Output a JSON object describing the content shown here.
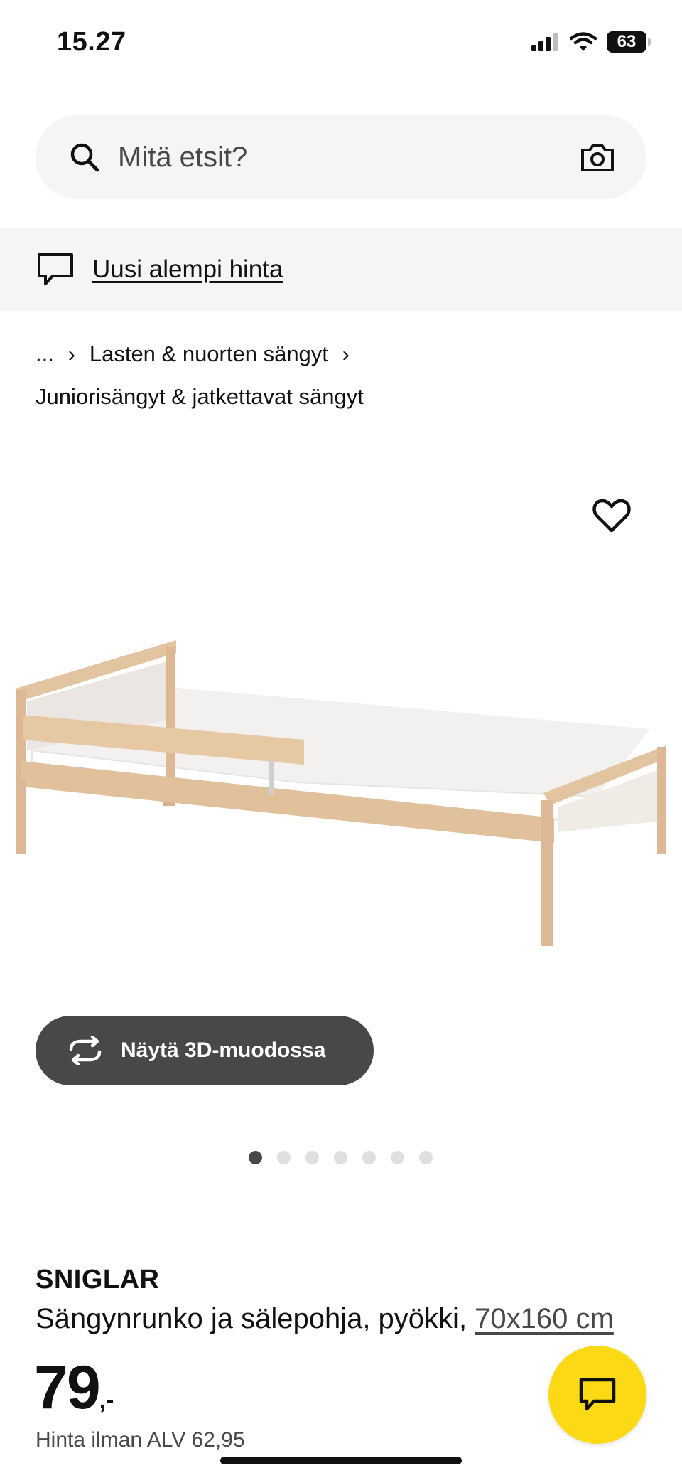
{
  "status_bar": {
    "time": "15.27",
    "battery": "63"
  },
  "search": {
    "placeholder": "Mitä etsit?"
  },
  "notice": {
    "link_label": "Uusi alempi hinta"
  },
  "breadcrumb": {
    "items": [
      "...",
      "Lasten & nuorten sängyt",
      "Juniorisängyt & jatkettavat sängyt"
    ],
    "separator": "›"
  },
  "gallery": {
    "view_3d_label": "Näytä 3D-muodossa",
    "image_count": 7,
    "active_index": 0
  },
  "product": {
    "brand": "SNIGLAR",
    "description": "Sängynrunko ja sälepohja, pyökki, ",
    "size_link": "70x160 cm",
    "price_integer": "79",
    "price_suffix": ",-",
    "price_excl_vat": "Hinta ilman ALV 62,95"
  },
  "colors": {
    "accent_yellow": "#fbd914",
    "dark_gray": "#484848",
    "light_gray": "#f5f5f5",
    "wood": "#e3c4a0"
  },
  "icons": [
    "signal-icon",
    "wifi-icon",
    "battery-icon",
    "search-icon",
    "camera-icon",
    "chat-outline-icon",
    "heart-icon",
    "rotate-3d-icon",
    "chat-icon"
  ]
}
